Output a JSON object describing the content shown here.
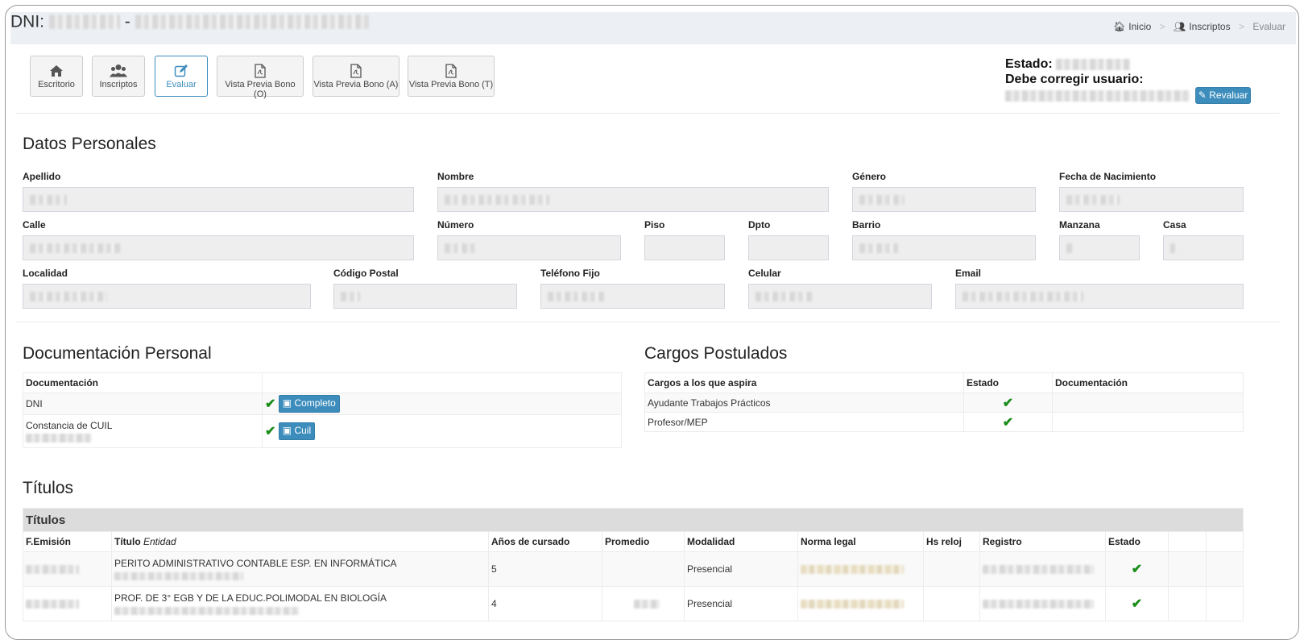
{
  "header": {
    "dni_label": "DNI:",
    "dni_separator": "-"
  },
  "breadcrumb": {
    "items": [
      {
        "label": "Inicio",
        "icon": "home-icon"
      },
      {
        "label": "Inscriptos",
        "icon": "users-icon"
      },
      {
        "label": "Evaluar",
        "icon": ""
      }
    ]
  },
  "toolbar": {
    "buttons": [
      {
        "label": "Escritorio",
        "icon": "home-icon"
      },
      {
        "label": "Inscriptos",
        "icon": "users-icon"
      },
      {
        "label": "Evaluar",
        "icon": "edit-icon",
        "active": true
      },
      {
        "label": "Vista Previa Bono (O)",
        "icon": "file-pdf-icon"
      },
      {
        "label": "Vista Previa Bono (A)",
        "icon": "file-pdf-icon"
      },
      {
        "label": "Vista Previa Bono (T)",
        "icon": "file-pdf-icon"
      }
    ]
  },
  "status": {
    "estado_label": "Estado:",
    "corregir_label": "Debe corregir usuario:",
    "revaluar_label": "Revaluar"
  },
  "datos_personales": {
    "title": "Datos Personales",
    "fields": {
      "apellido": "Apellido",
      "nombre": "Nombre",
      "genero": "Género",
      "fecha_nacimiento": "Fecha de Nacimiento",
      "calle": "Calle",
      "numero": "Número",
      "piso": "Piso",
      "dpto": "Dpto",
      "barrio": "Barrio",
      "manzana": "Manzana",
      "casa": "Casa",
      "localidad": "Localidad",
      "codigo_postal": "Código Postal",
      "telefono_fijo": "Teléfono Fijo",
      "celular": "Celular",
      "email": "Email"
    }
  },
  "documentacion": {
    "title": "Documentación Personal",
    "header": "Documentación",
    "rows": [
      {
        "label": "DNI",
        "button": "Completo"
      },
      {
        "label": "Constancia de CUIL",
        "button": "Cuil"
      }
    ]
  },
  "cargos": {
    "title": "Cargos Postulados",
    "headers": [
      "Cargos a los que aspira",
      "Estado",
      "Documentación"
    ],
    "rows": [
      {
        "cargo": "Ayudante Trabajos Prácticos"
      },
      {
        "cargo": "Profesor/MEP"
      }
    ]
  },
  "titulos": {
    "section_title": "Títulos",
    "table_title": "Títulos",
    "headers": {
      "f_emision": "F.Emisión",
      "titulo": "Título",
      "entidad": "Entidad",
      "anios": "Años de cursado",
      "promedio": "Promedio",
      "modalidad": "Modalidad",
      "norma": "Norma legal",
      "hs": "Hs reloj",
      "registro": "Registro",
      "estado": "Estado"
    },
    "rows": [
      {
        "titulo": "PERITO ADMINISTRATIVO CONTABLE ESP. EN INFORMÁTICA",
        "anios": "5",
        "modalidad": "Presencial"
      },
      {
        "titulo": "PROF. DE 3° EGB Y DE LA EDUC.POLIMODAL EN BIOLOGÍA",
        "anios": "4",
        "modalidad": "Presencial"
      }
    ]
  },
  "colors": {
    "primary": "#3c8dbc",
    "check": "#1a8c1a",
    "header_bg": "#ecf0f5"
  }
}
